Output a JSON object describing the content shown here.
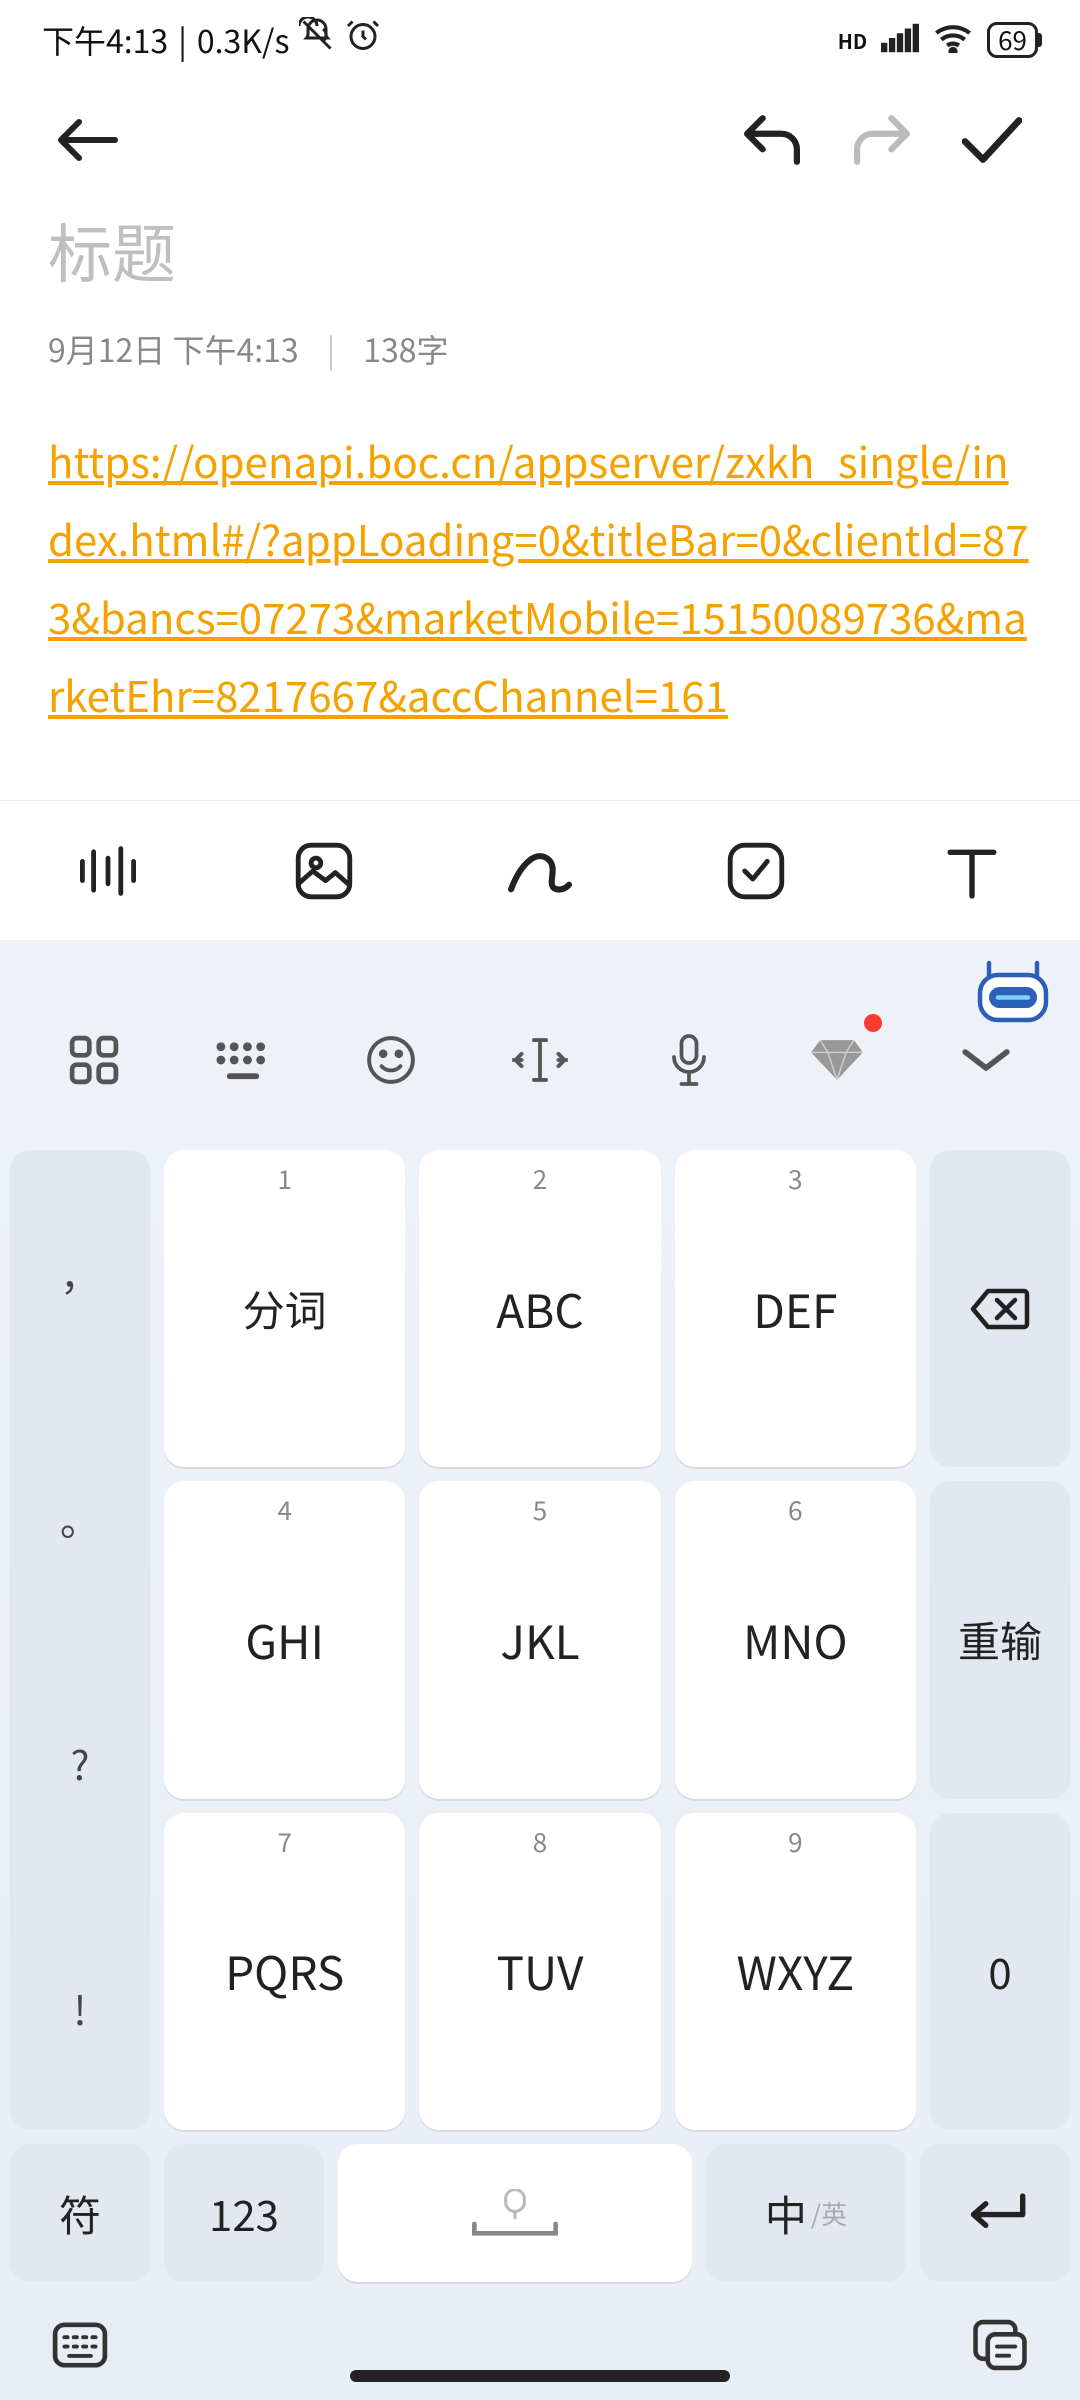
{
  "status": {
    "time": "下午4:13",
    "net_speed": "0.3K/s",
    "battery": "69",
    "icons": {
      "mute": "mute-icon",
      "alarm": "alarm-icon",
      "signal": "signal-icon",
      "wifi": "wifi-icon",
      "hd": "HD"
    }
  },
  "header": {
    "back": "back",
    "undo": "undo",
    "redo": "redo",
    "confirm": "confirm"
  },
  "editor": {
    "title_placeholder": "标题",
    "date": "9月12日 下午4:13",
    "word_count": "138字",
    "body_link": "https://openapi.boc.cn/appserver/zxkh_single/index.html#/?appLoading=0&titleBar=0&clientId=873&bancs=07273&marketMobile=15150089736&marketEhr=8217667&accChannel=161"
  },
  "toolbar": {
    "items": [
      "voice",
      "image",
      "draw",
      "checklist",
      "text"
    ]
  },
  "keyboard": {
    "top": [
      "apps",
      "keyboard-layout",
      "emoji",
      "cursor-move",
      "mic",
      "diamond",
      "collapse"
    ],
    "left_col": [
      "，",
      "。",
      "?",
      "!"
    ],
    "keys": [
      {
        "num": "1",
        "label": "分词"
      },
      {
        "num": "2",
        "label": "ABC"
      },
      {
        "num": "3",
        "label": "DEF"
      },
      {
        "num": "4",
        "label": "GHI"
      },
      {
        "num": "5",
        "label": "JKL"
      },
      {
        "num": "6",
        "label": "MNO"
      },
      {
        "num": "7",
        "label": "PQRS"
      },
      {
        "num": "8",
        "label": "TUV"
      },
      {
        "num": "9",
        "label": "WXYZ"
      }
    ],
    "right": {
      "backspace": "⌫",
      "reinput": "重输",
      "zero": "0"
    },
    "bottom": {
      "symbols": "符",
      "numbers": "123",
      "space": "space",
      "lang_main": "中",
      "lang_sub": "/英",
      "enter": "↵"
    }
  }
}
